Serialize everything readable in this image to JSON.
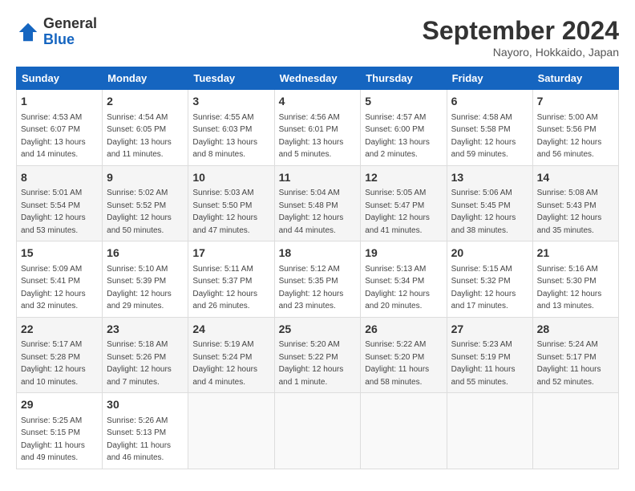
{
  "logo": {
    "general": "General",
    "blue": "Blue"
  },
  "header": {
    "month": "September 2024",
    "location": "Nayoro, Hokkaido, Japan"
  },
  "weekdays": [
    "Sunday",
    "Monday",
    "Tuesday",
    "Wednesday",
    "Thursday",
    "Friday",
    "Saturday"
  ],
  "weeks": [
    [
      {
        "day": "1",
        "sunrise": "4:53 AM",
        "sunset": "6:07 PM",
        "daylight": "13 hours and 14 minutes."
      },
      {
        "day": "2",
        "sunrise": "4:54 AM",
        "sunset": "6:05 PM",
        "daylight": "13 hours and 11 minutes."
      },
      {
        "day": "3",
        "sunrise": "4:55 AM",
        "sunset": "6:03 PM",
        "daylight": "13 hours and 8 minutes."
      },
      {
        "day": "4",
        "sunrise": "4:56 AM",
        "sunset": "6:01 PM",
        "daylight": "13 hours and 5 minutes."
      },
      {
        "day": "5",
        "sunrise": "4:57 AM",
        "sunset": "6:00 PM",
        "daylight": "13 hours and 2 minutes."
      },
      {
        "day": "6",
        "sunrise": "4:58 AM",
        "sunset": "5:58 PM",
        "daylight": "12 hours and 59 minutes."
      },
      {
        "day": "7",
        "sunrise": "5:00 AM",
        "sunset": "5:56 PM",
        "daylight": "12 hours and 56 minutes."
      }
    ],
    [
      {
        "day": "8",
        "sunrise": "5:01 AM",
        "sunset": "5:54 PM",
        "daylight": "12 hours and 53 minutes."
      },
      {
        "day": "9",
        "sunrise": "5:02 AM",
        "sunset": "5:52 PM",
        "daylight": "12 hours and 50 minutes."
      },
      {
        "day": "10",
        "sunrise": "5:03 AM",
        "sunset": "5:50 PM",
        "daylight": "12 hours and 47 minutes."
      },
      {
        "day": "11",
        "sunrise": "5:04 AM",
        "sunset": "5:48 PM",
        "daylight": "12 hours and 44 minutes."
      },
      {
        "day": "12",
        "sunrise": "5:05 AM",
        "sunset": "5:47 PM",
        "daylight": "12 hours and 41 minutes."
      },
      {
        "day": "13",
        "sunrise": "5:06 AM",
        "sunset": "5:45 PM",
        "daylight": "12 hours and 38 minutes."
      },
      {
        "day": "14",
        "sunrise": "5:08 AM",
        "sunset": "5:43 PM",
        "daylight": "12 hours and 35 minutes."
      }
    ],
    [
      {
        "day": "15",
        "sunrise": "5:09 AM",
        "sunset": "5:41 PM",
        "daylight": "12 hours and 32 minutes."
      },
      {
        "day": "16",
        "sunrise": "5:10 AM",
        "sunset": "5:39 PM",
        "daylight": "12 hours and 29 minutes."
      },
      {
        "day": "17",
        "sunrise": "5:11 AM",
        "sunset": "5:37 PM",
        "daylight": "12 hours and 26 minutes."
      },
      {
        "day": "18",
        "sunrise": "5:12 AM",
        "sunset": "5:35 PM",
        "daylight": "12 hours and 23 minutes."
      },
      {
        "day": "19",
        "sunrise": "5:13 AM",
        "sunset": "5:34 PM",
        "daylight": "12 hours and 20 minutes."
      },
      {
        "day": "20",
        "sunrise": "5:15 AM",
        "sunset": "5:32 PM",
        "daylight": "12 hours and 17 minutes."
      },
      {
        "day": "21",
        "sunrise": "5:16 AM",
        "sunset": "5:30 PM",
        "daylight": "12 hours and 13 minutes."
      }
    ],
    [
      {
        "day": "22",
        "sunrise": "5:17 AM",
        "sunset": "5:28 PM",
        "daylight": "12 hours and 10 minutes."
      },
      {
        "day": "23",
        "sunrise": "5:18 AM",
        "sunset": "5:26 PM",
        "daylight": "12 hours and 7 minutes."
      },
      {
        "day": "24",
        "sunrise": "5:19 AM",
        "sunset": "5:24 PM",
        "daylight": "12 hours and 4 minutes."
      },
      {
        "day": "25",
        "sunrise": "5:20 AM",
        "sunset": "5:22 PM",
        "daylight": "12 hours and 1 minute."
      },
      {
        "day": "26",
        "sunrise": "5:22 AM",
        "sunset": "5:20 PM",
        "daylight": "11 hours and 58 minutes."
      },
      {
        "day": "27",
        "sunrise": "5:23 AM",
        "sunset": "5:19 PM",
        "daylight": "11 hours and 55 minutes."
      },
      {
        "day": "28",
        "sunrise": "5:24 AM",
        "sunset": "5:17 PM",
        "daylight": "11 hours and 52 minutes."
      }
    ],
    [
      {
        "day": "29",
        "sunrise": "5:25 AM",
        "sunset": "5:15 PM",
        "daylight": "11 hours and 49 minutes."
      },
      {
        "day": "30",
        "sunrise": "5:26 AM",
        "sunset": "5:13 PM",
        "daylight": "11 hours and 46 minutes."
      },
      null,
      null,
      null,
      null,
      null
    ]
  ],
  "labels": {
    "sunrise": "Sunrise:",
    "sunset": "Sunset:",
    "daylight": "Daylight:"
  }
}
